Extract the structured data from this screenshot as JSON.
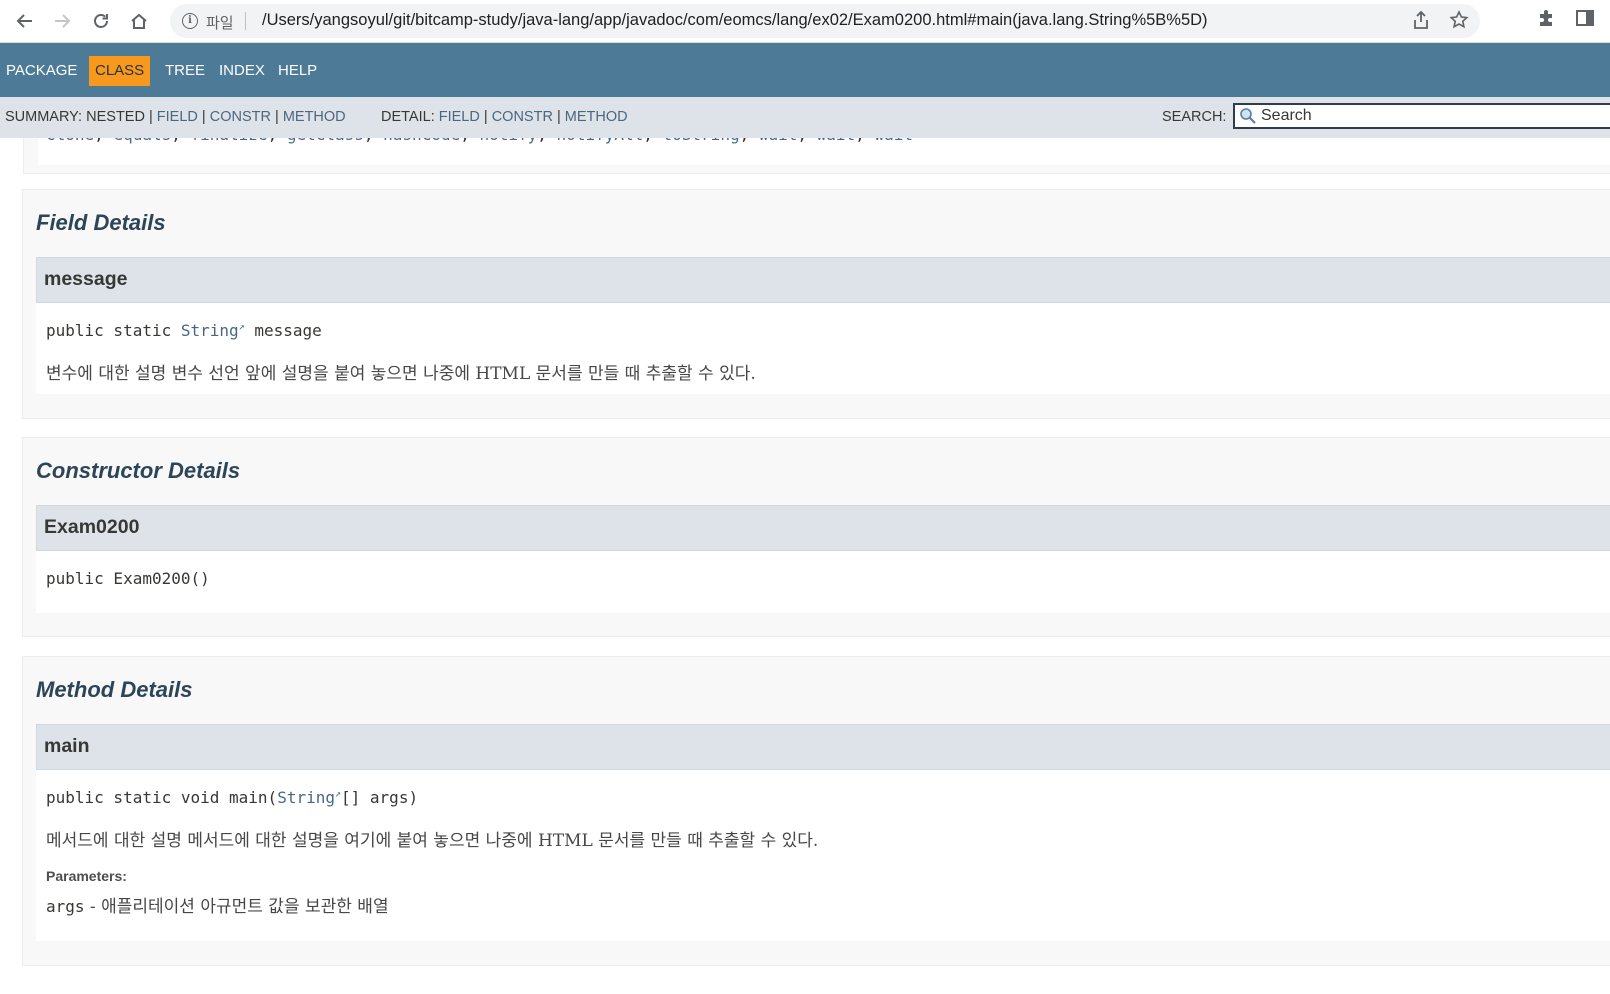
{
  "browser": {
    "scheme_label": "파일",
    "url": "/Users/yangsoyul/git/bitcamp-study/java-lang/app/javadoc/com/eomcs/lang/ex02/Exam0200.html#main(java.lang.String%5B%5D)",
    "icons": [
      "back-icon",
      "forward-icon",
      "reload-icon",
      "home-icon",
      "info-icon",
      "share-icon",
      "star-icon",
      "extensions-icon",
      "side-panel-icon"
    ]
  },
  "top_nav": {
    "items": [
      "PACKAGE",
      "CLASS",
      "TREE",
      "INDEX",
      "HELP"
    ],
    "active": "CLASS"
  },
  "sub_nav": {
    "summary_label": "SUMMARY:",
    "summary_nested": "NESTED",
    "summary_links": [
      "FIELD",
      "CONSTR",
      "METHOD"
    ],
    "detail_label": "DETAIL:",
    "detail_links": [
      "FIELD",
      "CONSTR",
      "METHOD"
    ],
    "separator": "|",
    "search_label": "SEARCH:",
    "search_placeholder": "Search"
  },
  "inherited": {
    "methods": [
      "clone",
      "equals",
      "finalize",
      "getClass",
      "hashCode",
      "notify",
      "notifyAll",
      "toString",
      "wait",
      "wait",
      "wait"
    ]
  },
  "field_details": {
    "heading": "Field Details",
    "name": "message",
    "sig_prefix": "public static ",
    "sig_type": "String",
    "sig_suffix": " message",
    "description": "변수에 대한 설명 변수 선언 앞에 설명을 붙여 놓으면 나중에 HTML 문서를 만들 때 추출할 수 있다."
  },
  "constructor_details": {
    "heading": "Constructor Details",
    "name": "Exam0200",
    "signature": "public Exam0200()"
  },
  "method_details": {
    "heading": "Method Details",
    "name": "main",
    "sig_prefix": "public static void main(",
    "sig_type": "String",
    "sig_suffix": "[] args)",
    "description": "메서드에 대한 설명 메서드에 대한 설명을 여기에 붙여 놓으면 나중에 HTML 문서를 만들 때 추출할 수 있다.",
    "params_label": "Parameters:",
    "param_name": "args",
    "param_dash": " - ",
    "param_desc": "애플리테이션 아규먼트 값을 보관한 배열"
  },
  "colors": {
    "nav_bg": "#4d7a97",
    "nav_active": "#f8981d",
    "subnav_bg": "#dee3e9",
    "link": "#4a6782"
  }
}
